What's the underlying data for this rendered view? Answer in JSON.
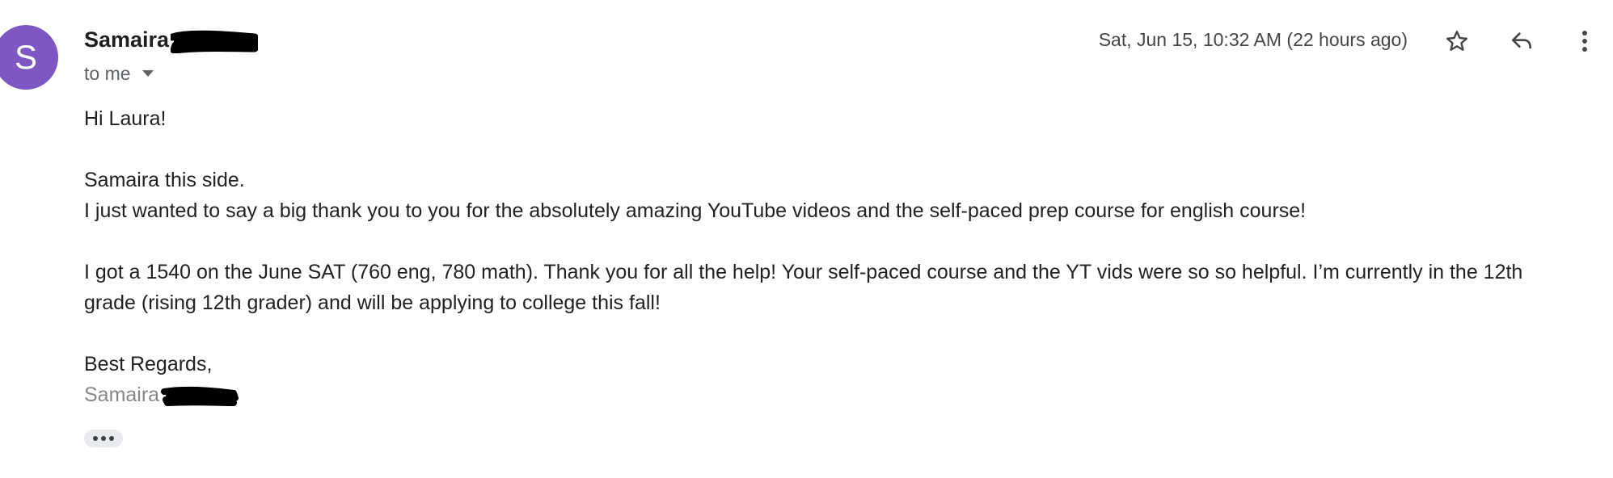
{
  "sender": {
    "avatar_letter": "S",
    "avatar_color": "#7e57c2",
    "name": "Samaira",
    "name_redacted": true
  },
  "recipient": {
    "label": "to me"
  },
  "timestamp": "Sat, Jun 15, 10:32 AM (22 hours ago)",
  "actions": {
    "star_icon": "star-outline-icon",
    "reply_icon": "reply-arrow-icon",
    "more_icon": "more-vertical-icon"
  },
  "body": {
    "greeting": "Hi Laura!",
    "line1": "Samaira this side.",
    "line2": "I just wanted to say a big thank you to you for the absolutely amazing YouTube videos and the self-paced prep course for english course!",
    "line3": "I got a 1540 on the June SAT (760 eng, 780 math). Thank you for all the help! Your self-paced course and the YT vids were so so helpful. I’m currently in the 12th",
    "line4": "grade (rising 12th grader) and will be applying to college this fall!",
    "closing": "Best Regards,",
    "signature": "Samaira",
    "signature_redacted": true
  },
  "trimmed_content_icon": "three-dots-icon"
}
